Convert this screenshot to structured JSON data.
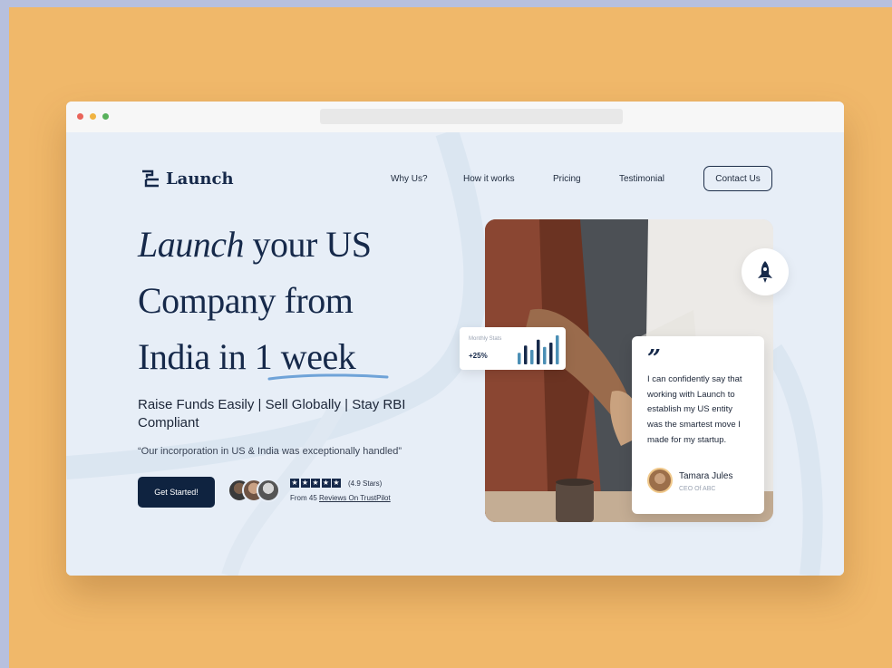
{
  "nav": {
    "brand": "Launch",
    "items": [
      "Why Us?",
      "How it works",
      "Pricing",
      "Testimonial"
    ],
    "cta": "Contact Us"
  },
  "hero": {
    "line1_italic": "Launch",
    "line1_rest": " your US",
    "line2": "Company from",
    "line3": "India in 1 week",
    "subheading": "Raise Funds Easily | Sell Globally | Stay RBI Compliant",
    "quote": "“Our incorporation in US & India was exceptionally handled”",
    "cta": "Get Started!",
    "rating_label": "(4.9 Stars)",
    "reviews_prefix": "From 45 ",
    "reviews_link": "Reviews On TrustPilot",
    "rating_stars": 5
  },
  "stats_card": {
    "label": "Monthly Stats",
    "value": "+25%",
    "bars": [
      0.4,
      0.65,
      0.5,
      0.85,
      0.6,
      0.75,
      1.0
    ]
  },
  "testimonial": {
    "quote_mark": "”",
    "text": "I can confidently say that working with Launch to establish my US entity was the smartest move I made for my startup.",
    "name": "Tamara Jules",
    "role": "CEO Of ABC"
  },
  "colors": {
    "navy": "#16294a",
    "accent_underline": "#6fa3d8",
    "page_bg": "#e7eef7",
    "outer_bg": "#f0b86a",
    "bar_teal": "#4b8fb5"
  },
  "icons": {
    "logo": "launch-logo-icon",
    "rocket": "rocket-icon",
    "star": "star-icon"
  }
}
